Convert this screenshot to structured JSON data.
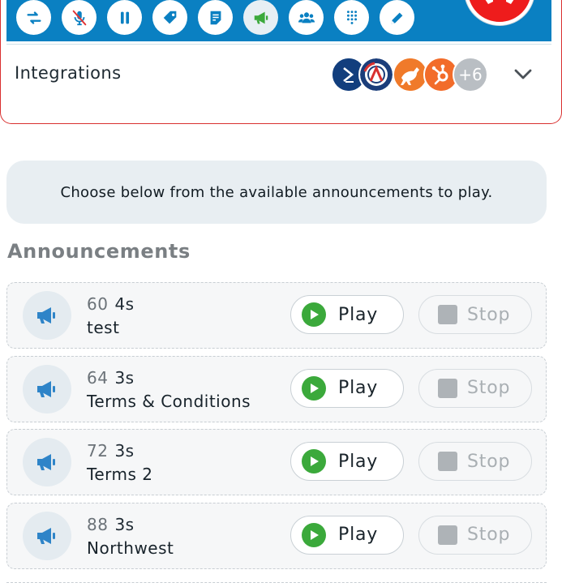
{
  "toolbar": {
    "buttons": [
      {
        "name": "transfer-icon",
        "active": false
      },
      {
        "name": "microphone-muted-icon",
        "active": false
      },
      {
        "name": "pause-icon",
        "active": false
      },
      {
        "name": "tag-icon",
        "active": false
      },
      {
        "name": "note-icon",
        "active": false
      },
      {
        "name": "megaphone-icon",
        "active": true
      },
      {
        "name": "group-icon",
        "active": false
      },
      {
        "name": "dialpad-icon",
        "active": false
      },
      {
        "name": "pencil-icon",
        "active": false
      }
    ],
    "hangup_color": "#ee1c1c",
    "accent": "#0a80c2"
  },
  "integrations": {
    "title": "Integrations",
    "more_count": "+6"
  },
  "info": {
    "text": "Choose below from the available announcements to play."
  },
  "announcements": {
    "title": "Announcements",
    "items": [
      {
        "id": "60",
        "duration": "4s",
        "name": "test",
        "play": "Play",
        "stop": "Stop"
      },
      {
        "id": "64",
        "duration": "3s",
        "name": "Terms & Conditions",
        "play": "Play",
        "stop": "Stop"
      },
      {
        "id": "72",
        "duration": "3s",
        "name": "Terms 2",
        "play": "Play",
        "stop": "Stop"
      },
      {
        "id": "88",
        "duration": "3s",
        "name": "Northwest",
        "play": "Play",
        "stop": "Stop"
      }
    ]
  }
}
